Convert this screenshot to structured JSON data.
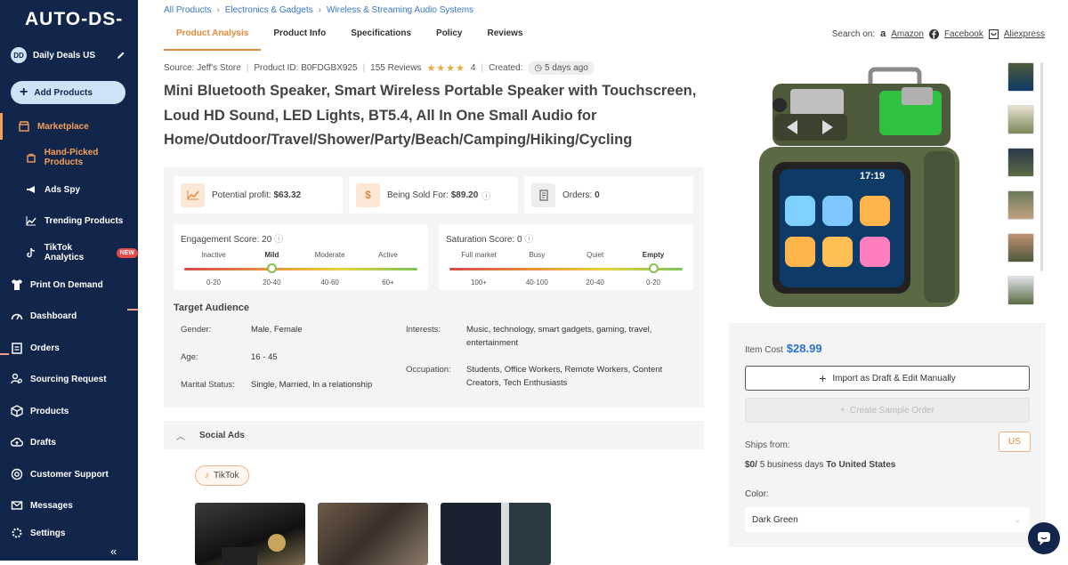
{
  "app": {
    "logo": "AUTO-DS-"
  },
  "sidebar": {
    "store_initials": "DD",
    "store_name": "Daily Deals US",
    "add_products": "Add Products",
    "items": [
      {
        "label": "Marketplace",
        "icon": "store-icon"
      },
      {
        "label": "Hand-Picked Products",
        "icon": "bag-icon"
      },
      {
        "label": "Ads Spy",
        "icon": "megaphone-icon"
      },
      {
        "label": "Trending Products",
        "icon": "trend-icon"
      },
      {
        "label": "TikTok Analytics",
        "icon": "tiktok-icon",
        "badge": "NEW"
      },
      {
        "label": "Print On Demand",
        "icon": "shirt-icon"
      },
      {
        "label": "Dashboard",
        "icon": "gauge-icon"
      },
      {
        "label": "Orders",
        "icon": "clipboard-icon"
      },
      {
        "label": "Sourcing Request",
        "icon": "person-search-icon"
      },
      {
        "label": "Products",
        "icon": "box-icon"
      },
      {
        "label": "Drafts",
        "icon": "cloud-upload-icon"
      },
      {
        "label": "Customer Support",
        "icon": "support-icon"
      },
      {
        "label": "Messages",
        "icon": "mail-icon"
      },
      {
        "label": "Settings",
        "icon": "gear-icon"
      }
    ],
    "collapse_icon": "«"
  },
  "breadcrumb": [
    "All Products",
    "Electronics & Gadgets",
    "Wireless & Streaming Audio Systems"
  ],
  "tabs": [
    "Product Analysis",
    "Product Info",
    "Specifications",
    "Policy",
    "Reviews"
  ],
  "search_on": {
    "label": "Search on:",
    "links": [
      "Amazon",
      "Facebook",
      "Aliexpress"
    ]
  },
  "meta": {
    "source": "Source: Jeff's Store",
    "product_id": "Product ID: B0FDGBX925",
    "reviews": "155 Reviews",
    "stars": "★★★★",
    "rating": "4",
    "created_label": "Created:",
    "created_value": "5 days ago"
  },
  "product_title": "Mini Bluetooth Speaker, Smart Wireless Portable Speaker with Touchscreen, Loud HD Sound, LED Lights, BT5.4, All In One Small Audio for Home/Outdoor/Travel/Shower/Party/Beach/Camping/Hiking/Cycling",
  "stats": {
    "profit_label": "Potential profit:",
    "profit_value": "$63.32",
    "sold_label": "Being Sold For:",
    "sold_value": "$89.20",
    "orders_label": "Orders:",
    "orders_value": "0"
  },
  "engagement": {
    "title": "Engagement Score: 20",
    "levels": [
      "Inactive",
      "Mild",
      "Moderate",
      "Active"
    ],
    "ranges": [
      "0-20",
      "20-40",
      "40-60",
      "60+"
    ],
    "selected_index": 1
  },
  "saturation": {
    "title": "Saturation Score: 0",
    "levels": [
      "Full market",
      "Busy",
      "Quiet",
      "Empty"
    ],
    "ranges": [
      "100+",
      "40-100",
      "20-40",
      "0-20"
    ],
    "selected_index": 3
  },
  "target_audience": {
    "title": "Target Audience",
    "gender_label": "Gender:",
    "gender": "Male, Female",
    "age_label": "Age:",
    "age": "16 - 45",
    "marital_label": "Marital Status:",
    "marital": "Single, Married, In a relationship",
    "interests_label": "Interests:",
    "interests": "Music, technology, smart gadgets, gaming, travel, entertainment",
    "occupation_label": "Occupation:",
    "occupation": "Students, Office Workers, Remote Workers, Content Creators, Tech Enthusiasts"
  },
  "social_ads": {
    "title": "Social Ads",
    "platform": "TikTok"
  },
  "product_screen_time": "17:19",
  "buy": {
    "item_cost_label": "Item Cost",
    "item_cost": "$28.99",
    "import_label": "Import as Draft & Edit Manually",
    "sample_label": "Create Sample Order",
    "ships_from_label": "Ships from:",
    "ships_from_country": "US",
    "shipping_cost": "$0/",
    "shipping_days": "5 business days",
    "shipping_dest": "To United States",
    "color_label": "Color:",
    "color_value": "Dark Green"
  },
  "colors": {
    "sidebar": "#12254b",
    "accent": "#e08a3a",
    "link": "#3a77c9",
    "price": "#2a6fd6"
  }
}
